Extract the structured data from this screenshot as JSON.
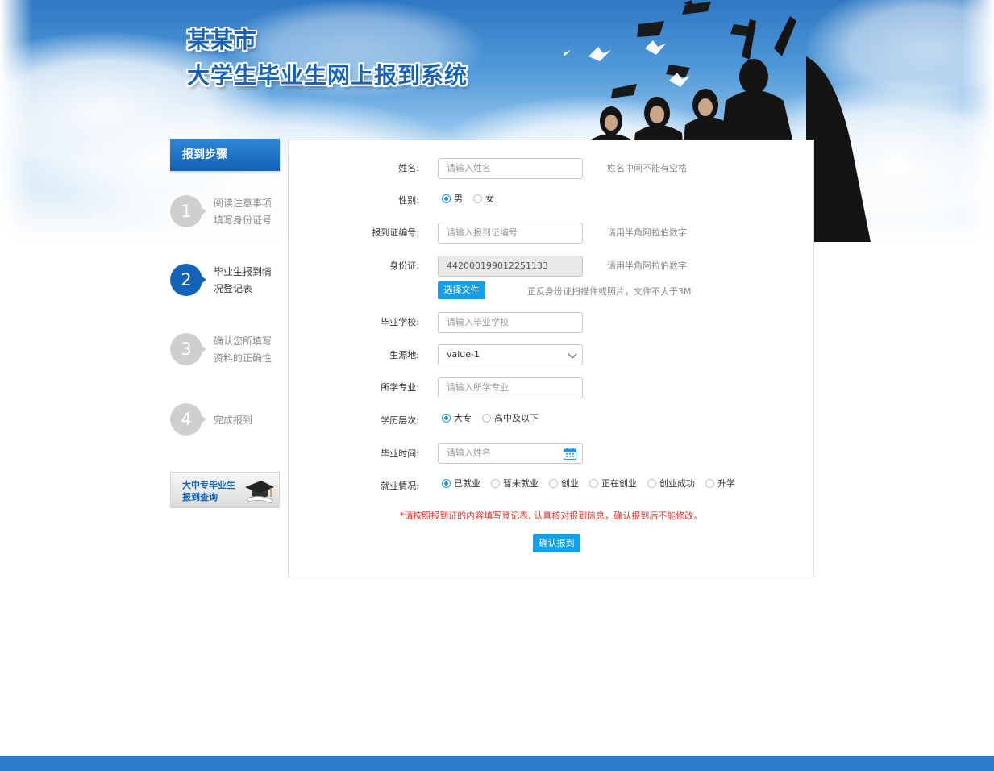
{
  "site": {
    "title_line1": "某某市",
    "title_line2": "大学生毕业生网上报到系统"
  },
  "sidebar": {
    "header": "报到步骤",
    "steps": [
      {
        "number": "1",
        "text": "阅读注意事项填写身份证号",
        "active": false
      },
      {
        "number": "2",
        "text": "毕业生报到情况登记表",
        "active": true
      },
      {
        "number": "3",
        "text": "确认您所填写资料的正确性",
        "active": false
      },
      {
        "number": "4",
        "text": "完成报到",
        "active": false
      }
    ],
    "query_line1": "大中专毕业生",
    "query_line2": "报到查询"
  },
  "form": {
    "name": {
      "label": "姓名:",
      "placeholder": "请输入姓名",
      "hint": "姓名中间不能有空格"
    },
    "gender": {
      "label": "性别:",
      "options": [
        "男",
        "女"
      ],
      "selected": "男"
    },
    "report_no": {
      "label": "报到证编号:",
      "placeholder": "请输入报到证编号",
      "hint": "请用半角阿拉伯数字"
    },
    "id_card": {
      "label": "身份证:",
      "value": "442000199012251133",
      "hint": "请用半角阿拉伯数字"
    },
    "file": {
      "button": "选择文件",
      "hint": "正反身份证扫描件或照片，文件不大于3M"
    },
    "school": {
      "label": "毕业学校:",
      "placeholder": "请输入毕业学校"
    },
    "origin": {
      "label": "生源地:",
      "value": "value-1"
    },
    "major": {
      "label": "所学专业:",
      "placeholder": "请输入所学专业"
    },
    "edu_level": {
      "label": "学历层次:",
      "options": [
        "大专",
        "高中及以下"
      ],
      "selected": "大专"
    },
    "grad_time": {
      "label": "毕业时间:",
      "placeholder": "请输入姓名"
    },
    "employment": {
      "label": "就业情况:",
      "options": [
        "已就业",
        "暂未就业",
        "创业",
        "正在创业",
        "创业成功",
        "升学"
      ],
      "selected": "已就业"
    },
    "note": "*请按照报到证的内容填写登记表, 认真核对报到信息，确认报到后不能修改。",
    "submit": "确认报到"
  },
  "colors": {
    "primary": "#1363b8",
    "button": "#12a0ec",
    "warning": "#e3322b",
    "footer": "#2b7ccb"
  }
}
